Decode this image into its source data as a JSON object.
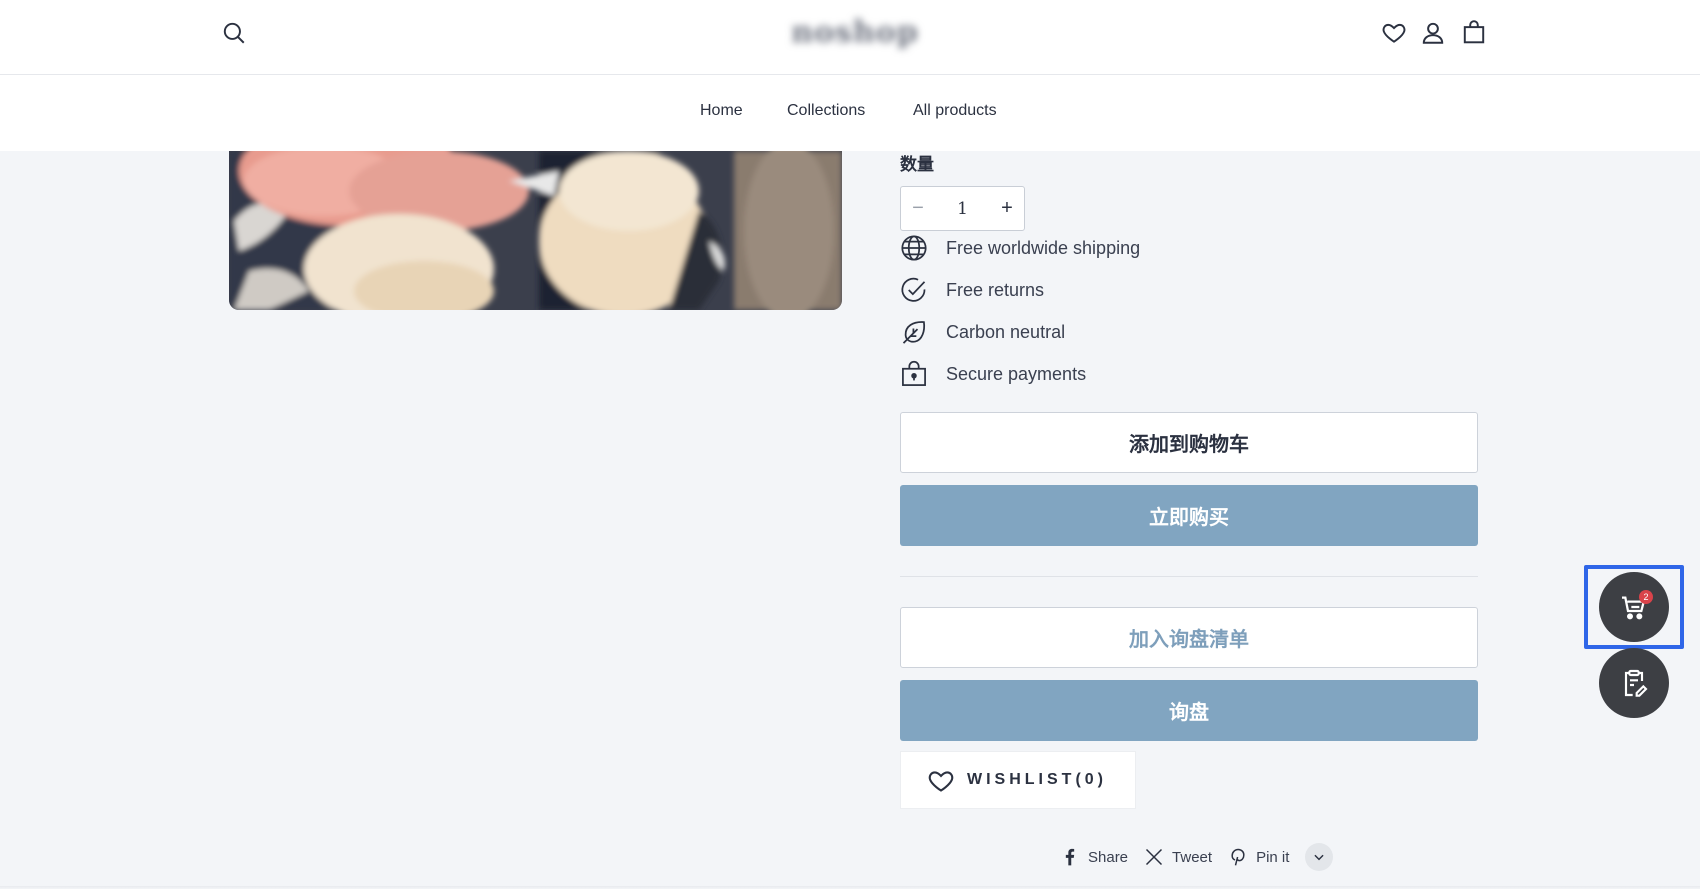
{
  "header": {
    "logo_text": "noshop",
    "icons": [
      "search-icon",
      "heart-icon",
      "user-icon",
      "bag-icon"
    ]
  },
  "nav": {
    "items": [
      {
        "label": "Home"
      },
      {
        "label": "Collections"
      },
      {
        "label": "All products"
      }
    ]
  },
  "product": {
    "quantity_label": "数量",
    "quantity_value": "1",
    "minus_symbol": "−",
    "plus_symbol": "+",
    "features": [
      {
        "icon": "globe-icon",
        "label": "Free worldwide shipping"
      },
      {
        "icon": "check-circle-icon",
        "label": "Free returns"
      },
      {
        "icon": "leaf-icon",
        "label": "Carbon neutral"
      },
      {
        "icon": "lock-bag-icon",
        "label": "Secure payments"
      }
    ],
    "add_to_cart_label": "添加到购物车",
    "buy_now_label": "立即购买",
    "add_inquiry_label": "加入询盘清单",
    "inquiry_label": "询盘",
    "wishlist_label": "WISHLIST(0)"
  },
  "share": {
    "items": [
      {
        "icon": "facebook-icon",
        "label": "Share"
      },
      {
        "icon": "x-icon",
        "label": "Tweet"
      },
      {
        "icon": "pinterest-icon",
        "label": "Pin it"
      }
    ],
    "more_icon": "chevron-down-icon"
  },
  "floating": {
    "cart_badge": "2",
    "cart_icon": "cart-icon",
    "inquiry_icon": "clipboard-edit-icon"
  },
  "colors": {
    "accent": "#81a5c1",
    "fab_bg": "#3d3f44",
    "highlight": "#2f66e8",
    "badge": "#d9434a"
  }
}
